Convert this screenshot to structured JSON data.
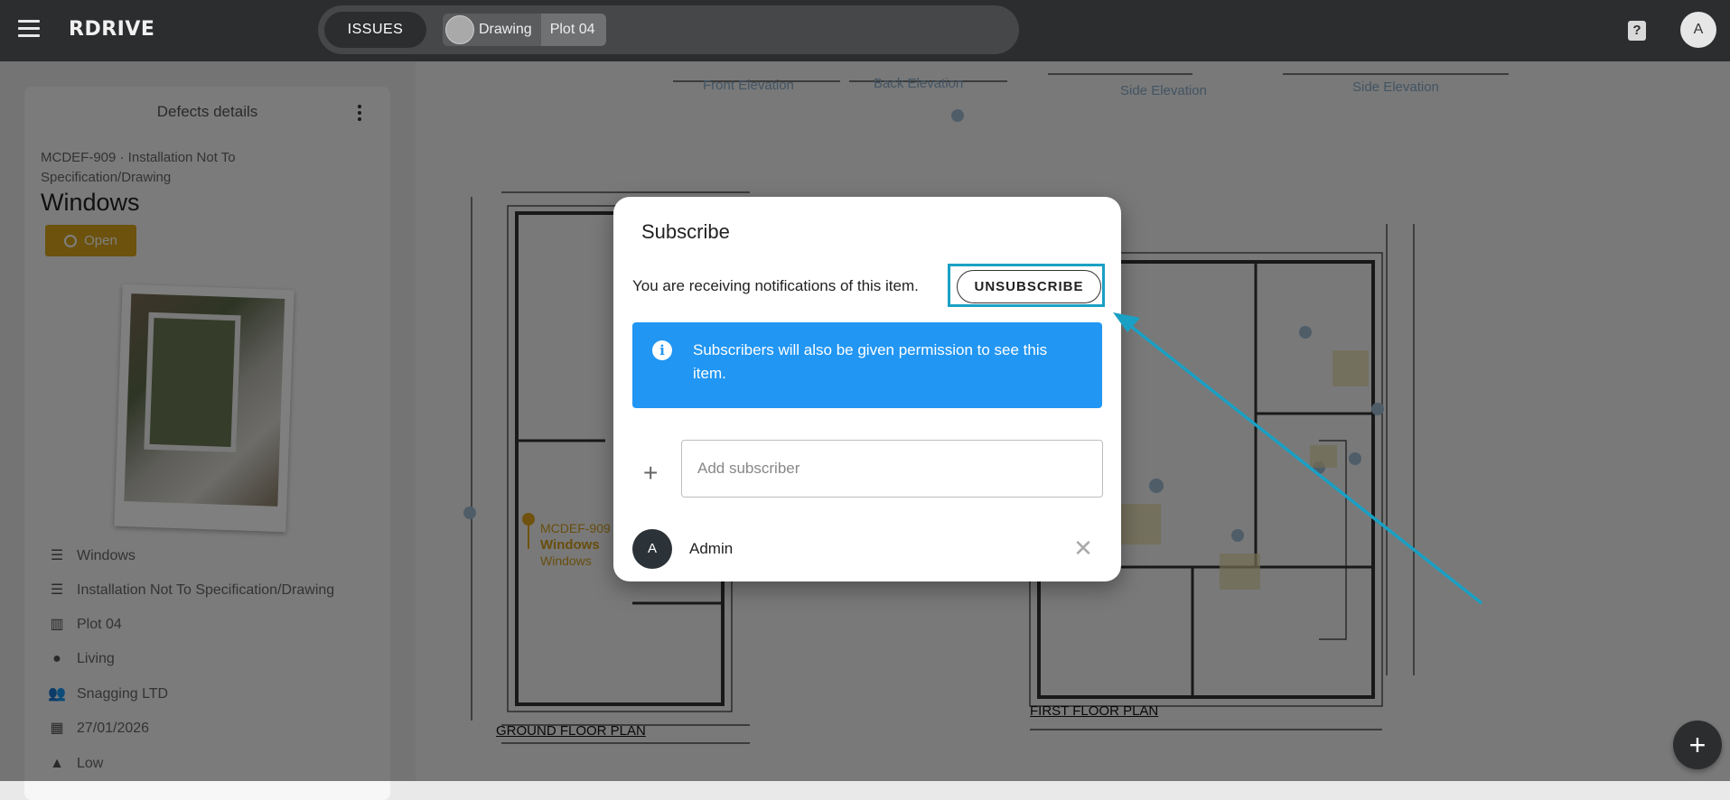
{
  "topbar": {
    "logo": "RDRIVE",
    "issues_label": "ISSUES",
    "breadcrumb_drawing": "Drawing",
    "breadcrumb_plot": "Plot 04",
    "avatar_letter": "A"
  },
  "drawing": {
    "elevations": [
      "Front Elevation",
      "Back Elevation",
      "Side Elevation",
      "Side Elevation"
    ],
    "ground_floor_label": "GROUND FLOOR PLAN",
    "first_floor_label": "FIRST FLOOR PLAN"
  },
  "panel": {
    "title": "Defects details",
    "code": "MCDEF-909 · Installation Not To Specification/Drawing",
    "defect_title": "Windows",
    "status": "Open",
    "meta": [
      {
        "icon": "list-icon",
        "text": "Windows"
      },
      {
        "icon": "list-icon",
        "text": "Installation Not To Specification/Drawing"
      },
      {
        "icon": "map-icon",
        "text": "Plot 04"
      },
      {
        "icon": "location-pin-icon",
        "text": "Living"
      },
      {
        "icon": "people-icon",
        "text": "Snagging LTD"
      },
      {
        "icon": "calendar-icon",
        "text": "27/01/2026"
      },
      {
        "icon": "warning-icon",
        "text": "Low"
      }
    ]
  },
  "modal": {
    "title": "Subscribe",
    "notif_text": "You are receiving notifications of this item.",
    "unsubscribe_label": "UNSUBSCRIBE",
    "info_text": "Subscribers will also be given permission to see this item.",
    "add_placeholder": "Add subscriber",
    "subscriber": {
      "initial": "A",
      "name": "Admin"
    }
  },
  "colors": {
    "accent": "#2196f3",
    "status_open": "#d9a51a",
    "highlight": "#1aa0c4",
    "topbar": "#2b2d2f"
  }
}
